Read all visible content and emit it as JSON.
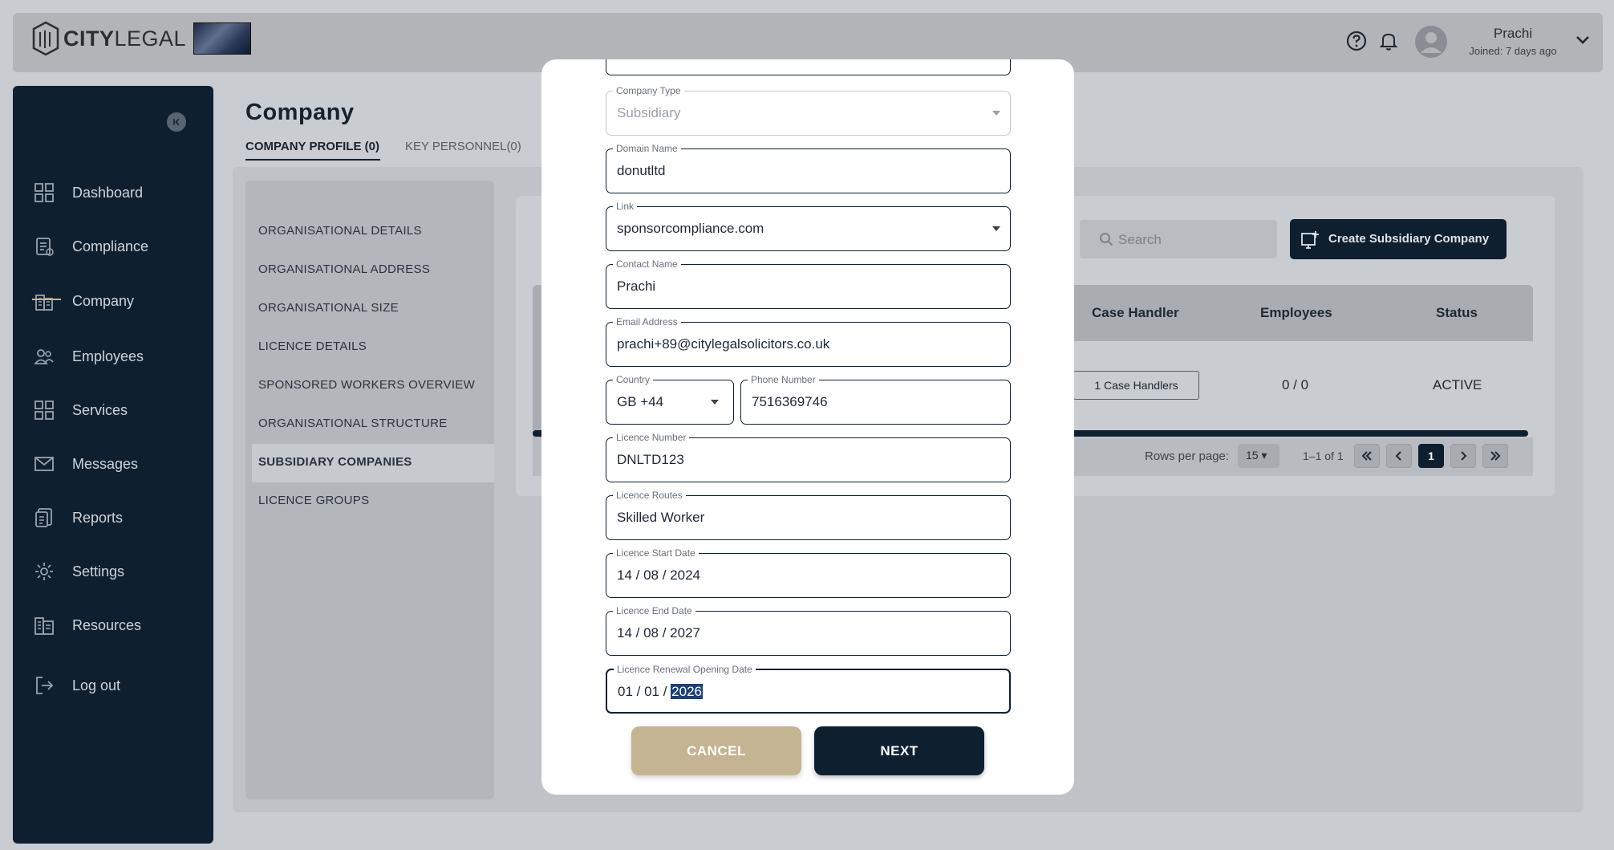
{
  "header": {
    "logo_text_bold": "CITY",
    "logo_text_light": "LEGAL",
    "user_name": "Prachi",
    "user_joined": "Joined: 7 days ago"
  },
  "sidebar": {
    "items": [
      {
        "label": "Dashboard",
        "icon": "dashboard-icon"
      },
      {
        "label": "Compliance",
        "icon": "compliance-icon"
      },
      {
        "label": "Company",
        "icon": "company-icon"
      },
      {
        "label": "Employees",
        "icon": "employees-icon"
      },
      {
        "label": "Services",
        "icon": "services-icon"
      },
      {
        "label": "Messages",
        "icon": "messages-icon"
      },
      {
        "label": "Reports",
        "icon": "reports-icon"
      },
      {
        "label": "Settings",
        "icon": "settings-icon"
      },
      {
        "label": "Resources",
        "icon": "resources-icon"
      },
      {
        "label": "Log out",
        "icon": "logout-icon"
      }
    ],
    "active": "Company"
  },
  "page": {
    "title": "Company",
    "tabs": [
      "COMPANY PROFILE (0)",
      "KEY PERSONNEL(0)"
    ]
  },
  "section_menu": {
    "items": [
      "ORGANISATIONAL DETAILS",
      "ORGANISATIONAL ADDRESS",
      "ORGANISATIONAL SIZE",
      "LICENCE DETAILS",
      "SPONSORED WORKERS OVERVIEW",
      "ORGANISATIONAL STRUCTURE",
      "SUBSIDIARY COMPANIES",
      "LICENCE GROUPS"
    ],
    "active": "SUBSIDIARY COMPANIES"
  },
  "subsidiaries": {
    "search_placeholder": "Search",
    "create_label": "Create Subsidiary Company",
    "columns": [
      "Case Handler",
      "Employees",
      "Status"
    ],
    "row": {
      "case_handler": "1 Case Handlers",
      "employees": "0 / 0",
      "status": "ACTIVE"
    },
    "rows_per_page_label": "Rows per page:",
    "rows_per_page": "15",
    "range": "1–1 of 1",
    "current_page": "1"
  },
  "modal": {
    "fields": {
      "company_type": {
        "label": "Company Type",
        "value": "Subsidiary"
      },
      "domain_name": {
        "label": "Domain Name",
        "value": "donutltd"
      },
      "link": {
        "label": "Link",
        "value": "sponsorcompliance.com"
      },
      "contact_name": {
        "label": "Contact Name",
        "value": "Prachi"
      },
      "email": {
        "label": "Email Address",
        "value": "prachi+89@citylegalsolicitors.co.uk"
      },
      "country": {
        "label": "Country",
        "value": "GB +44"
      },
      "phone": {
        "label": "Phone Number",
        "value": "7516369746"
      },
      "licence_number": {
        "label": "Licence Number",
        "value": "DNLTD123"
      },
      "licence_routes": {
        "label": "Licence Routes",
        "value": "Skilled Worker"
      },
      "licence_start": {
        "label": "Licence Start Date",
        "value": "14 / 08 / 2024"
      },
      "licence_end": {
        "label": "Licence End Date",
        "value": "14 / 08 / 2027"
      },
      "renewal_opening": {
        "label": "Licence Renewal Opening Date",
        "prefix": "01 / 01 / ",
        "selected": "2026"
      }
    },
    "cancel_label": "CANCEL",
    "next_label": "NEXT"
  },
  "colors": {
    "navy": "#0e2030",
    "gold": "#c5b491",
    "selection": "#1c3f78"
  }
}
